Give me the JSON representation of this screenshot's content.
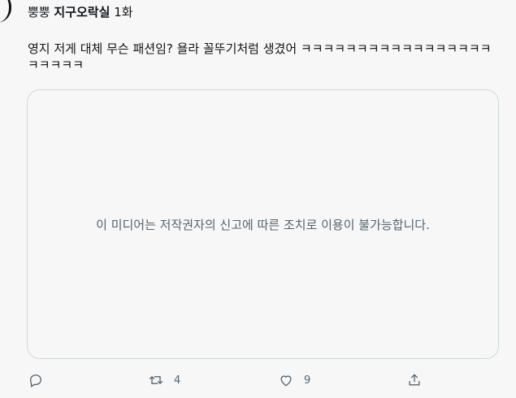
{
  "tweet": {
    "hashtag_prefix": "뿡뿡",
    "hashtag_title": "지구오락실",
    "hashtag_suffix": "1화",
    "text": "영지 저게 대체 무슨 패션임? 욜라 꼴뚜기처럼 생겼어 ㅋㅋㅋㅋㅋㅋㅋㅋㅋㅋㅋㅋㅋㅋㅋㅋㅋㅋㅋㅋㅋㅋ"
  },
  "media": {
    "notice": "이 미디어는 저작권자의 신고에 따른 조치로 이용이 불가능합니다."
  },
  "actions": {
    "reply_icon": "reply-icon",
    "retweet_icon": "retweet-icon",
    "retweet_count": "4",
    "like_icon": "heart-icon",
    "like_count": "9",
    "share_icon": "share-icon"
  },
  "colors": {
    "background": "#f7f7f7",
    "text": "#0f1419",
    "muted": "#536471",
    "border": "#cfd9de"
  }
}
